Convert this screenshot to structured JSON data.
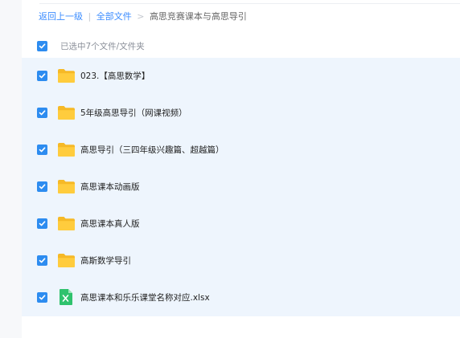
{
  "breadcrumb": {
    "back": "返回上一级",
    "sep1": "|",
    "all_files": "全部文件",
    "sep2": ">",
    "current": "高思竞赛课本与高思导引"
  },
  "selection": {
    "summary": "已选中7个文件/文件夹",
    "all_checked": true
  },
  "files": [
    {
      "name": "023.【高思数学】",
      "type": "folder",
      "checked": true
    },
    {
      "name": "5年级高思导引（网课视频）",
      "type": "folder",
      "checked": true
    },
    {
      "name": "高思导引（三四年级兴趣篇、超越篇）",
      "type": "folder",
      "checked": true
    },
    {
      "name": "高思课本动画版",
      "type": "folder",
      "checked": true
    },
    {
      "name": "高思课本真人版",
      "type": "folder",
      "checked": true
    },
    {
      "name": "高斯数学导引",
      "type": "folder",
      "checked": true
    },
    {
      "name": "高思课本和乐乐课堂名称对应.xlsx",
      "type": "xlsx",
      "checked": true
    }
  ],
  "colors": {
    "accent": "#2d8cf0",
    "link": "#3b8cff",
    "selected_row": "#eef5fd",
    "folder": "#ffc933",
    "excel": "#2fc26d"
  }
}
